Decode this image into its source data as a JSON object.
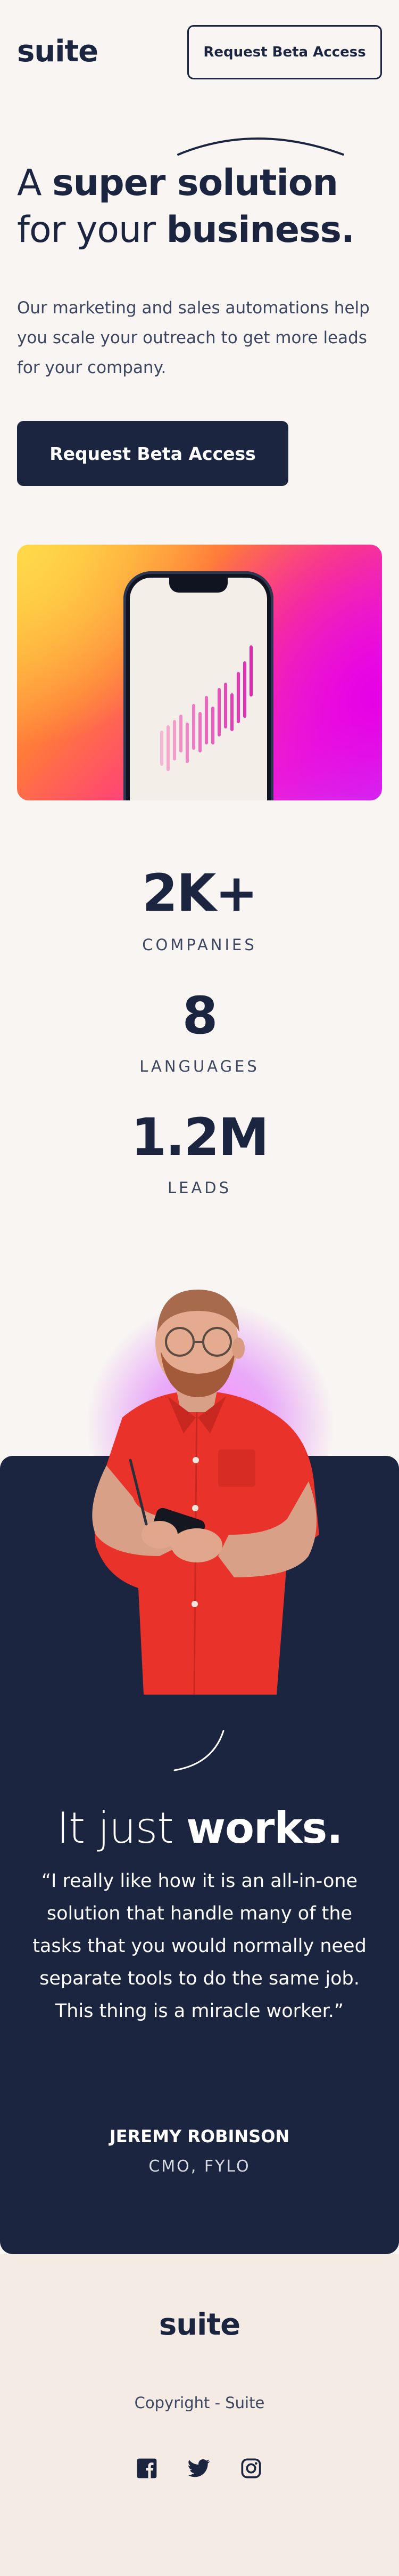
{
  "brand": {
    "logo": "suite"
  },
  "header": {
    "cta_label": "Request Beta Access"
  },
  "hero": {
    "title_line1_plain": "A ",
    "title_line1_bold": "super solution",
    "title_line2_plain": "for your ",
    "title_line2_bold": "business.",
    "description": "Our marketing and sales automations help you scale your outreach to get more leads for your company.",
    "cta_label": "Request Beta Access"
  },
  "hero_image": {
    "icon": "phone-with-chart",
    "gradient_colors": [
      "#ffc338",
      "#ff4b6e",
      "#ee2ad0",
      "#c04cff"
    ]
  },
  "stats": [
    {
      "value": "2K+",
      "label": "COMPANIES"
    },
    {
      "value": "8",
      "label": "LANGUAGES"
    },
    {
      "value": "1.2M",
      "label": "LEADS"
    }
  ],
  "testimonial": {
    "heading_plain": "It just ",
    "heading_bold": "works.",
    "quote": "“I really like how it is an all-in-one solution that handle many of the tasks that you would normally need separate tools to do the same job. This thing is a miracle worker.”",
    "author": "JEREMY ROBINSON",
    "role": "CMO, FYLO"
  },
  "footer": {
    "logo": "suite",
    "copyright": "Copyright - Suite",
    "socials": [
      {
        "icon": "facebook-icon"
      },
      {
        "icon": "twitter-icon"
      },
      {
        "icon": "instagram-icon"
      }
    ]
  },
  "colors": {
    "navy": "#1b2540",
    "background": "#f8f5f2",
    "footer_bg": "#f4ebe5",
    "shirt": "#e8322a"
  }
}
